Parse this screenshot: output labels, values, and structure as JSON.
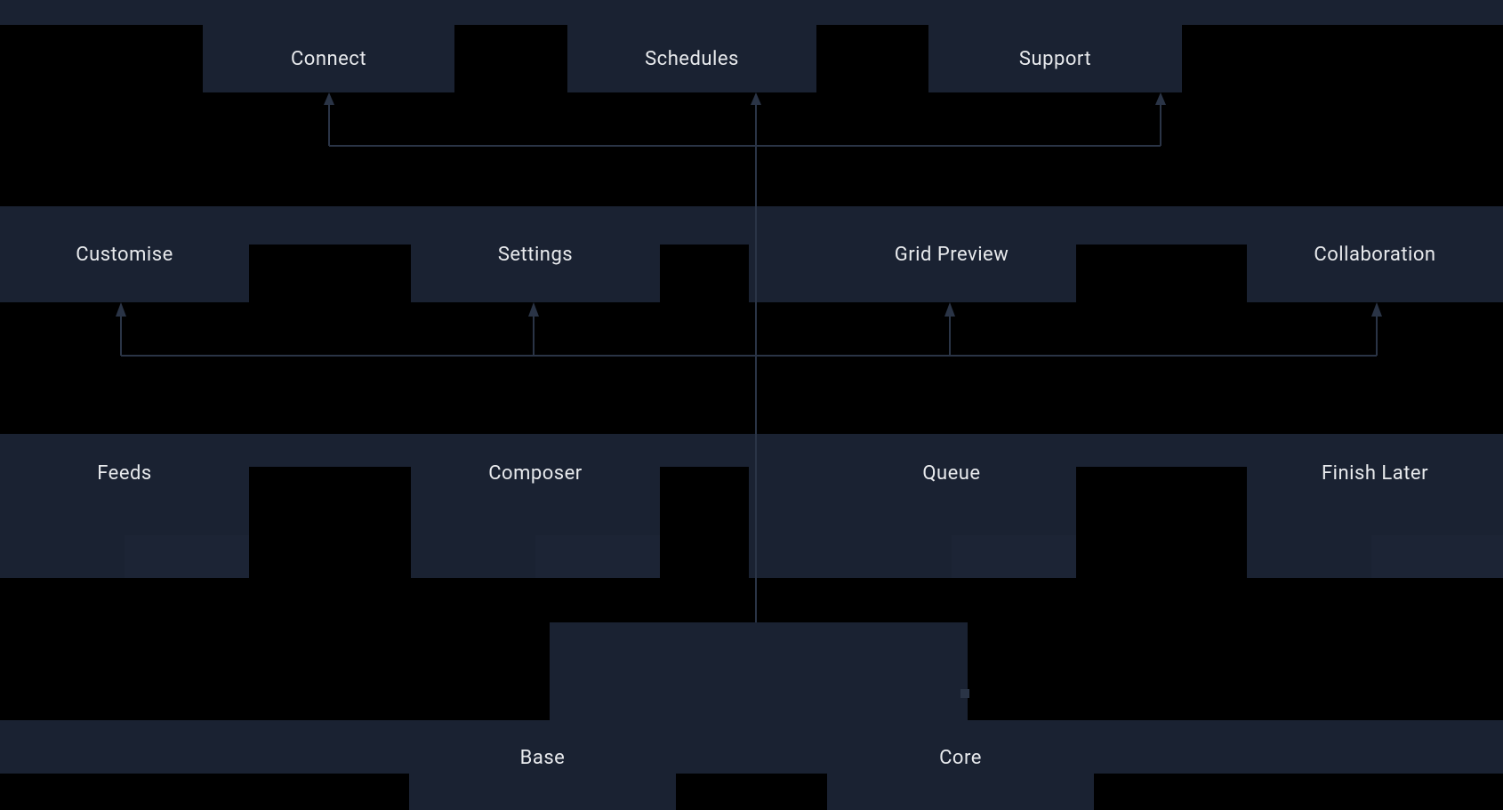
{
  "colors": {
    "background": "#000000",
    "box": "#1a2232",
    "text": "#e8eaed",
    "connector": "#2a3446"
  },
  "rows": {
    "top": {
      "items": [
        "Connect",
        "Schedules",
        "Support"
      ]
    },
    "second": {
      "items": [
        "Customise",
        "Settings",
        "Grid Preview",
        "Collaboration"
      ]
    },
    "third": {
      "items": [
        "Feeds",
        "Composer",
        "Queue",
        "Finish Later"
      ]
    },
    "bottom": {
      "items": [
        "Base",
        "Core"
      ]
    }
  }
}
